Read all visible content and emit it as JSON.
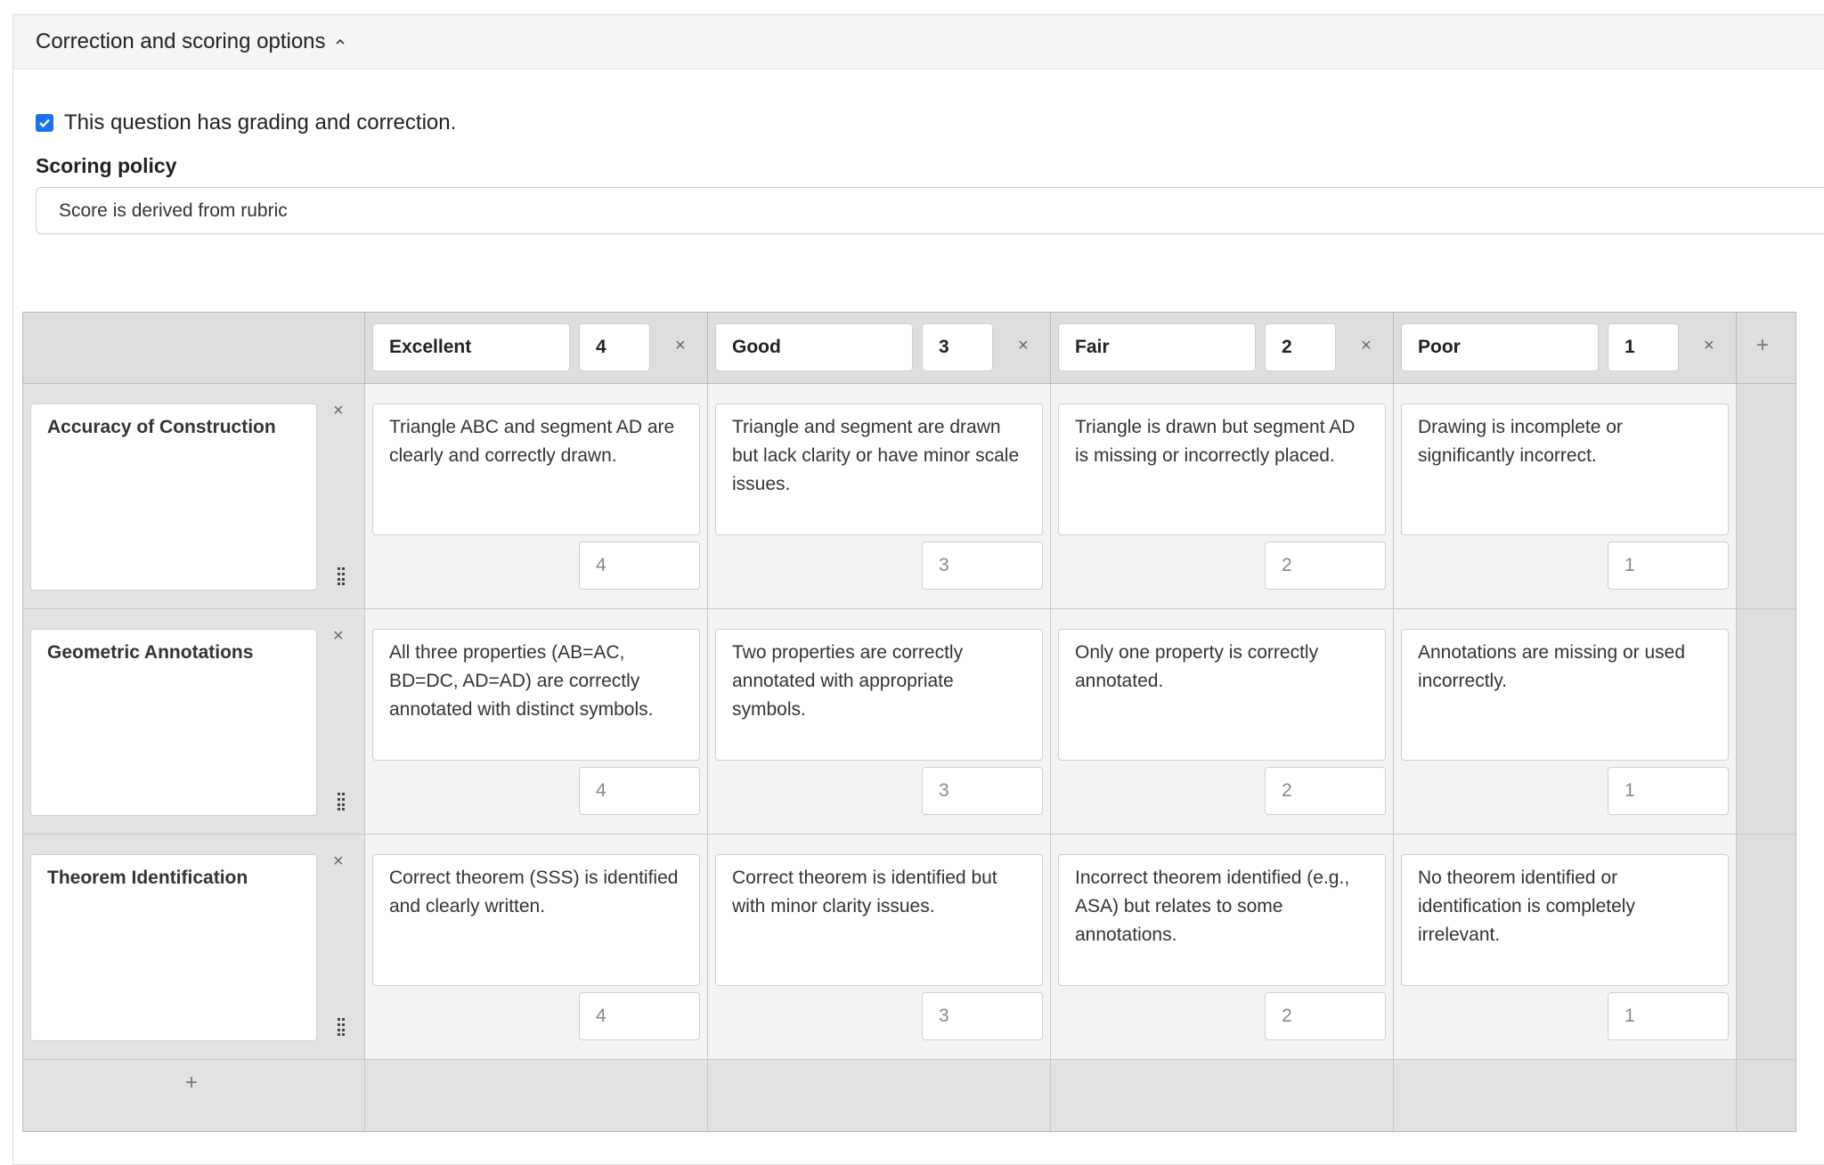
{
  "section": {
    "title": "Correction and scoring options"
  },
  "grading": {
    "checked": true,
    "label": "This question has grading and correction."
  },
  "policy": {
    "label": "Scoring policy",
    "value": "Score is derived from rubric"
  },
  "rubric": {
    "levels": [
      {
        "name": "Excellent",
        "points": "4"
      },
      {
        "name": "Good",
        "points": "3"
      },
      {
        "name": "Fair",
        "points": "2"
      },
      {
        "name": "Poor",
        "points": "1"
      }
    ],
    "criteria": [
      {
        "name": "Accuracy of Construction",
        "cells": [
          {
            "text": "Triangle ABC and segment AD are clearly and correctly drawn.",
            "points": "4"
          },
          {
            "text": "Triangle and segment are drawn but lack clarity or have minor scale issues.",
            "points": "3"
          },
          {
            "text": "Triangle is drawn but segment AD is missing or incorrectly placed.",
            "points": "2"
          },
          {
            "text": "Drawing is incomplete or significantly incorrect.",
            "points": "1"
          }
        ]
      },
      {
        "name": "Geometric Annotations",
        "cells": [
          {
            "text": "All three properties (AB=AC, BD=DC, AD=AD) are correctly annotated with distinct symbols.",
            "points": "4"
          },
          {
            "text": "Two properties are correctly annotated with appropriate symbols.",
            "points": "3"
          },
          {
            "text": "Only one property is correctly annotated.",
            "points": "2"
          },
          {
            "text": "Annotations are missing or used incorrectly.",
            "points": "1"
          }
        ]
      },
      {
        "name": "Theorem Identification",
        "cells": [
          {
            "text": "Correct theorem (SSS) is identified and clearly written.",
            "points": "4"
          },
          {
            "text": "Correct theorem is identified but with minor clarity issues.",
            "points": "3"
          },
          {
            "text": "Incorrect theorem identified (e.g., ASA) but relates to some annotations.",
            "points": "2"
          },
          {
            "text": "No theorem identified or identification is completely irrelevant.",
            "points": "1"
          }
        ]
      }
    ],
    "icons": {
      "remove": "close-icon",
      "add": "plus-icon",
      "drag": "drag-handle-icon"
    }
  }
}
